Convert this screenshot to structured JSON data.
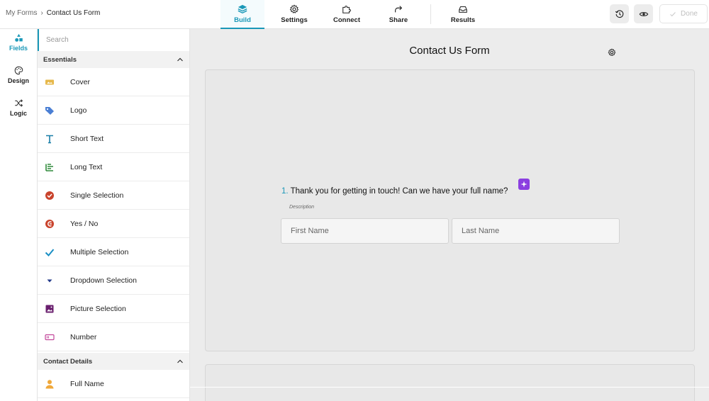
{
  "breadcrumb": {
    "parent": "My Forms",
    "separator": "›",
    "current": "Contact Us Form"
  },
  "nav": {
    "tabs": [
      {
        "label": "Build",
        "icon": "layers-icon",
        "active": true
      },
      {
        "label": "Settings",
        "icon": "gear-icon",
        "active": false
      },
      {
        "label": "Connect",
        "icon": "puzzle-icon",
        "active": false
      },
      {
        "label": "Share",
        "icon": "share-arrow-icon",
        "active": false
      },
      {
        "label": "Results",
        "icon": "inbox-icon",
        "active": false
      }
    ]
  },
  "toolbar": {
    "done_label": "Done"
  },
  "rail": {
    "items": [
      {
        "label": "Fields",
        "icon": "shapes-icon",
        "active": true
      },
      {
        "label": "Design",
        "icon": "palette-icon",
        "active": false
      },
      {
        "label": "Logic",
        "icon": "shuffle-icon",
        "active": false
      }
    ]
  },
  "panel": {
    "search_placeholder": "Search",
    "sections": [
      {
        "title": "Essentials"
      },
      {
        "title": "Contact Details"
      }
    ],
    "essentials": [
      {
        "label": "Cover",
        "icon": "cover-image-icon"
      },
      {
        "label": "Logo",
        "icon": "tag-icon"
      },
      {
        "label": "Short Text",
        "icon": "text-t-icon"
      },
      {
        "label": "Long Text",
        "icon": "long-text-icon"
      },
      {
        "label": "Single Selection",
        "icon": "radio-check-icon"
      },
      {
        "label": "Yes / No",
        "icon": "yes-no-icon"
      },
      {
        "label": "Multiple Selection",
        "icon": "checkmark-icon"
      },
      {
        "label": "Dropdown Selection",
        "icon": "dropdown-caret-icon"
      },
      {
        "label": "Picture Selection",
        "icon": "picture-icon"
      },
      {
        "label": "Number",
        "icon": "number-icon"
      }
    ],
    "contact": [
      {
        "label": "Full Name",
        "icon": "person-icon"
      }
    ]
  },
  "form": {
    "title": "Contact Us Form",
    "question": {
      "number": "1.",
      "text": "Thank you for getting in touch! Can we have your full name?",
      "description": "Description",
      "fields": [
        {
          "placeholder": "First Name"
        },
        {
          "placeholder": "Last Name"
        }
      ]
    }
  },
  "colors": {
    "accent": "#1a98b8",
    "ai_badge": "#8b3fe0",
    "canvas_bg": "#ececec"
  }
}
